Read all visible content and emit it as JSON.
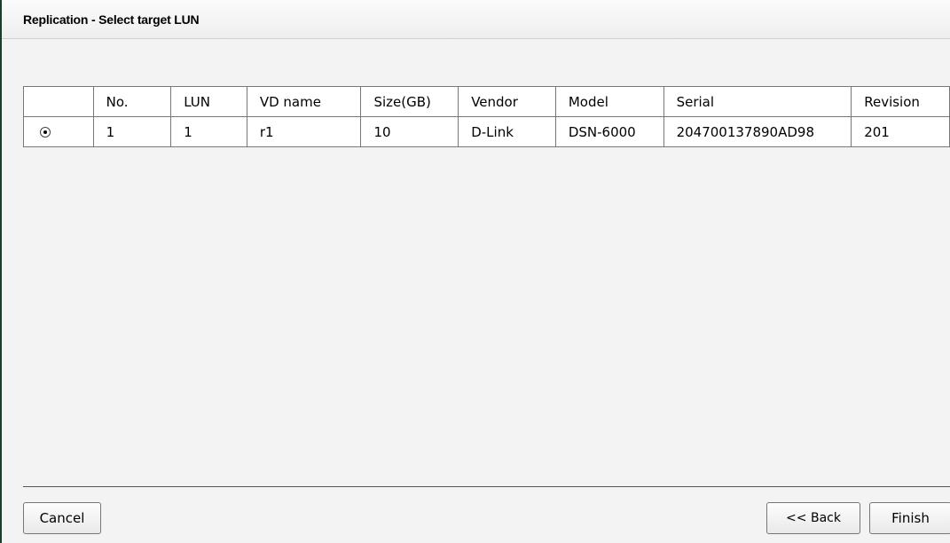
{
  "window": {
    "title": "Replication - Select target LUN"
  },
  "table": {
    "columns": [
      "",
      "No.",
      "LUN",
      "VD name",
      "Size(GB)",
      "Vendor",
      "Model",
      "Serial",
      "Revision"
    ],
    "rows": [
      {
        "selected": true,
        "no": "1",
        "lun": "1",
        "vd_name": "r1",
        "size_gb": "10",
        "vendor": "D-Link",
        "model": "DSN-6000",
        "serial": "204700137890AD98",
        "revision": "201"
      }
    ]
  },
  "buttons": {
    "cancel": "Cancel",
    "back": "<< Back",
    "finish": "Finish"
  }
}
